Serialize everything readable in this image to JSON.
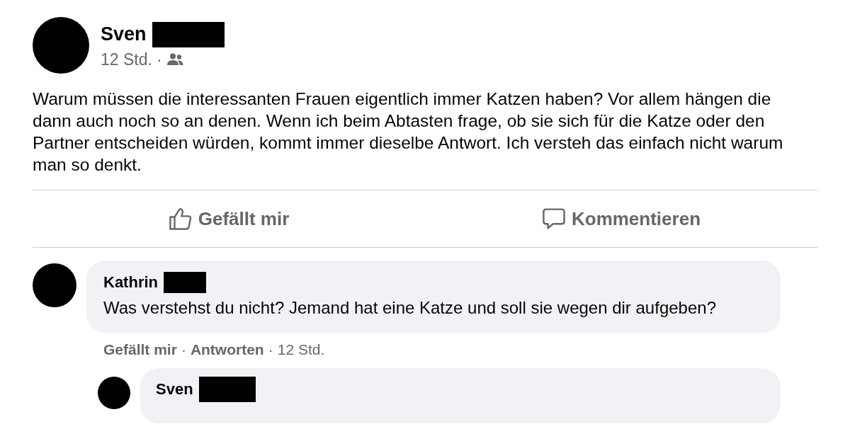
{
  "post": {
    "author": "Sven",
    "time": "12 Std.",
    "separator": "·",
    "text": "Warum müssen die interessanten Frauen eigentlich immer Katzen haben? Vor allem hängen die dann auch noch so an denen. Wenn ich beim Abtasten frage, ob sie sich für die Katze oder den Partner entscheiden würden, kommt immer dieselbe Antwort. Ich versteh das einfach nicht warum man so denkt."
  },
  "actions": [
    {
      "kind": "like",
      "label": "Gefällt mir"
    },
    {
      "kind": "comment",
      "label": "Kommentieren"
    }
  ],
  "comments": [
    {
      "author": "Kathrin",
      "text": "Was verstehst du nicht? Jemand hat eine Katze und soll sie wegen dir aufgeben?",
      "like": "Gefällt mir",
      "reply": "Antworten",
      "time": "12 Std.",
      "separator": "·",
      "replies": [
        {
          "author": "Sven"
        }
      ]
    }
  ]
}
